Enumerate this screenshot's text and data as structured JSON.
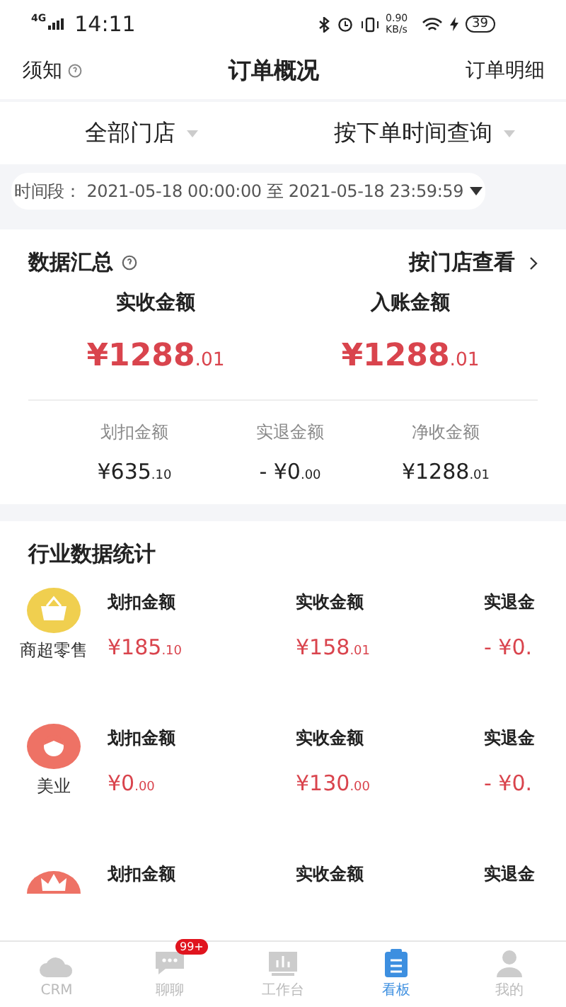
{
  "status_bar": {
    "network": "4G",
    "time": "14:11",
    "speed": "0.90 KB/s",
    "battery": "39"
  },
  "header": {
    "left": "须知",
    "title": "订单概况",
    "right": "订单明细"
  },
  "filters": [
    {
      "label": "全部门店"
    },
    {
      "label": "按下单时间查询"
    }
  ],
  "time_range": {
    "label": "时间段：",
    "value": "2021-05-18 00:00:00 至 2021-05-18 23:59:59"
  },
  "summary": {
    "title": "数据汇总",
    "link": "按门店查看",
    "main": [
      {
        "label": "实收金额",
        "amount": "¥1288",
        "fraction": ".01"
      },
      {
        "label": "入账金额",
        "amount": "¥1288",
        "fraction": ".01"
      }
    ],
    "sub": [
      {
        "label": "划扣金额",
        "amount": "¥635",
        "fraction": ".10"
      },
      {
        "label": "实退金额",
        "amount": "- ¥0",
        "fraction": ".00"
      },
      {
        "label": "净收金额",
        "amount": "¥1288",
        "fraction": ".01"
      }
    ]
  },
  "industry": {
    "title": "行业数据统计",
    "rows": [
      {
        "name": "商超零售",
        "kind": "basket",
        "metrics": [
          {
            "label": "划扣金额",
            "amount": "¥185",
            "fraction": ".10"
          },
          {
            "label": "实收金额",
            "amount": "¥158",
            "fraction": ".01"
          },
          {
            "label": "实退金",
            "amount": "- ¥0."
          }
        ]
      },
      {
        "name": "美业",
        "kind": "beauty",
        "metrics": [
          {
            "label": "划扣金额",
            "amount": "¥0",
            "fraction": ".00"
          },
          {
            "label": "实收金额",
            "amount": "¥130",
            "fraction": ".00"
          },
          {
            "label": "实退金",
            "amount": "- ¥0."
          }
        ]
      },
      {
        "kind": "crown",
        "metrics": [
          {
            "label": "划扣金额"
          },
          {
            "label": "实收金额"
          },
          {
            "label": "实退金"
          }
        ]
      }
    ]
  },
  "tabs": [
    {
      "label": "CRM",
      "kind": "crm",
      "selected": false
    },
    {
      "label": "聊聊",
      "kind": "chat",
      "selected": false,
      "badge": "99+"
    },
    {
      "label": "工作台",
      "kind": "desk",
      "selected": false
    },
    {
      "label": "看板",
      "kind": "board",
      "selected": true
    },
    {
      "label": "我的",
      "kind": "me",
      "selected": false
    }
  ]
}
